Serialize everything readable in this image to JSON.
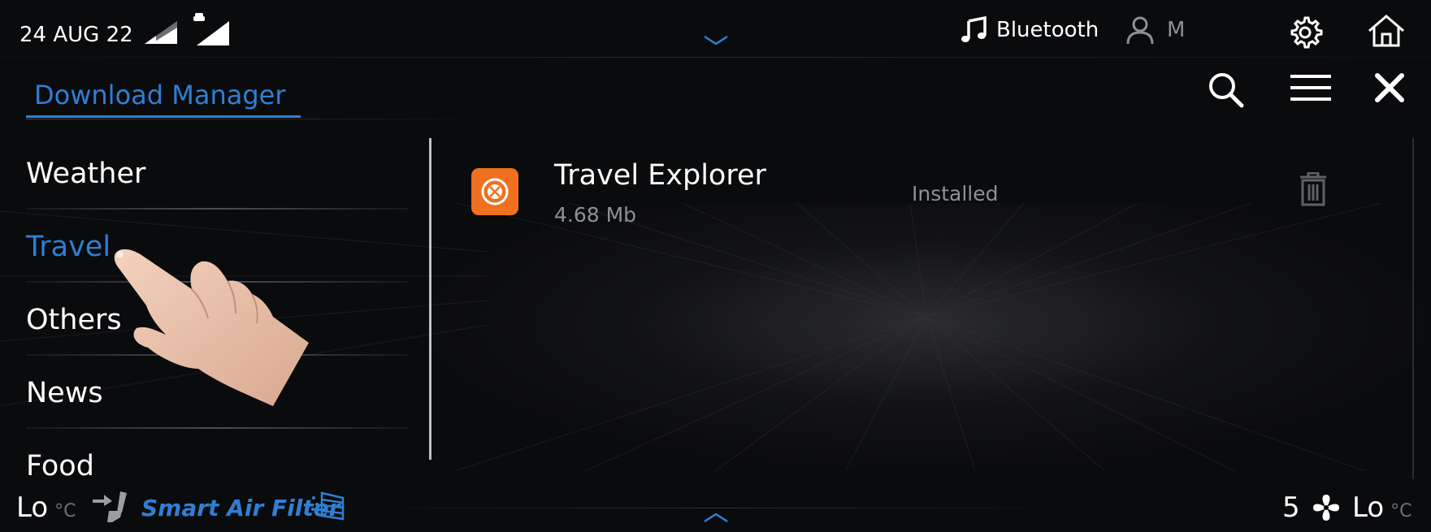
{
  "status_bar": {
    "date": "24 AUG 22",
    "bluetooth_label": "Bluetooth",
    "user_label": "M"
  },
  "title_bar": {
    "title": "Download Manager"
  },
  "sidebar": {
    "items": [
      {
        "label": "Weather",
        "active": false
      },
      {
        "label": "Travel",
        "active": true
      },
      {
        "label": "Others",
        "active": false
      },
      {
        "label": "News",
        "active": false
      },
      {
        "label": "Food",
        "active": false
      }
    ]
  },
  "downloads": [
    {
      "name": "Travel Explorer",
      "size": "4.68 Mb",
      "status": "Installed"
    }
  ],
  "climate": {
    "left_temp": "Lo",
    "right_temp": "Lo",
    "unit": "°C",
    "air_filter_label": "Smart Air Filter",
    "fan_speed": "5"
  },
  "colors": {
    "accent": "#2f7fd4",
    "app_icon": "#f0701f",
    "background": "#0a0b0d"
  },
  "icons": [
    "signal-icon",
    "car-signal-icon",
    "music-note-icon",
    "user-icon",
    "gear-icon",
    "home-icon",
    "search-icon",
    "menu-icon",
    "close-icon",
    "trash-icon",
    "seat-icon",
    "air-filter-icon",
    "fan-icon",
    "chevron-down-icon",
    "chevron-up-icon",
    "hand-pointer-icon"
  ]
}
